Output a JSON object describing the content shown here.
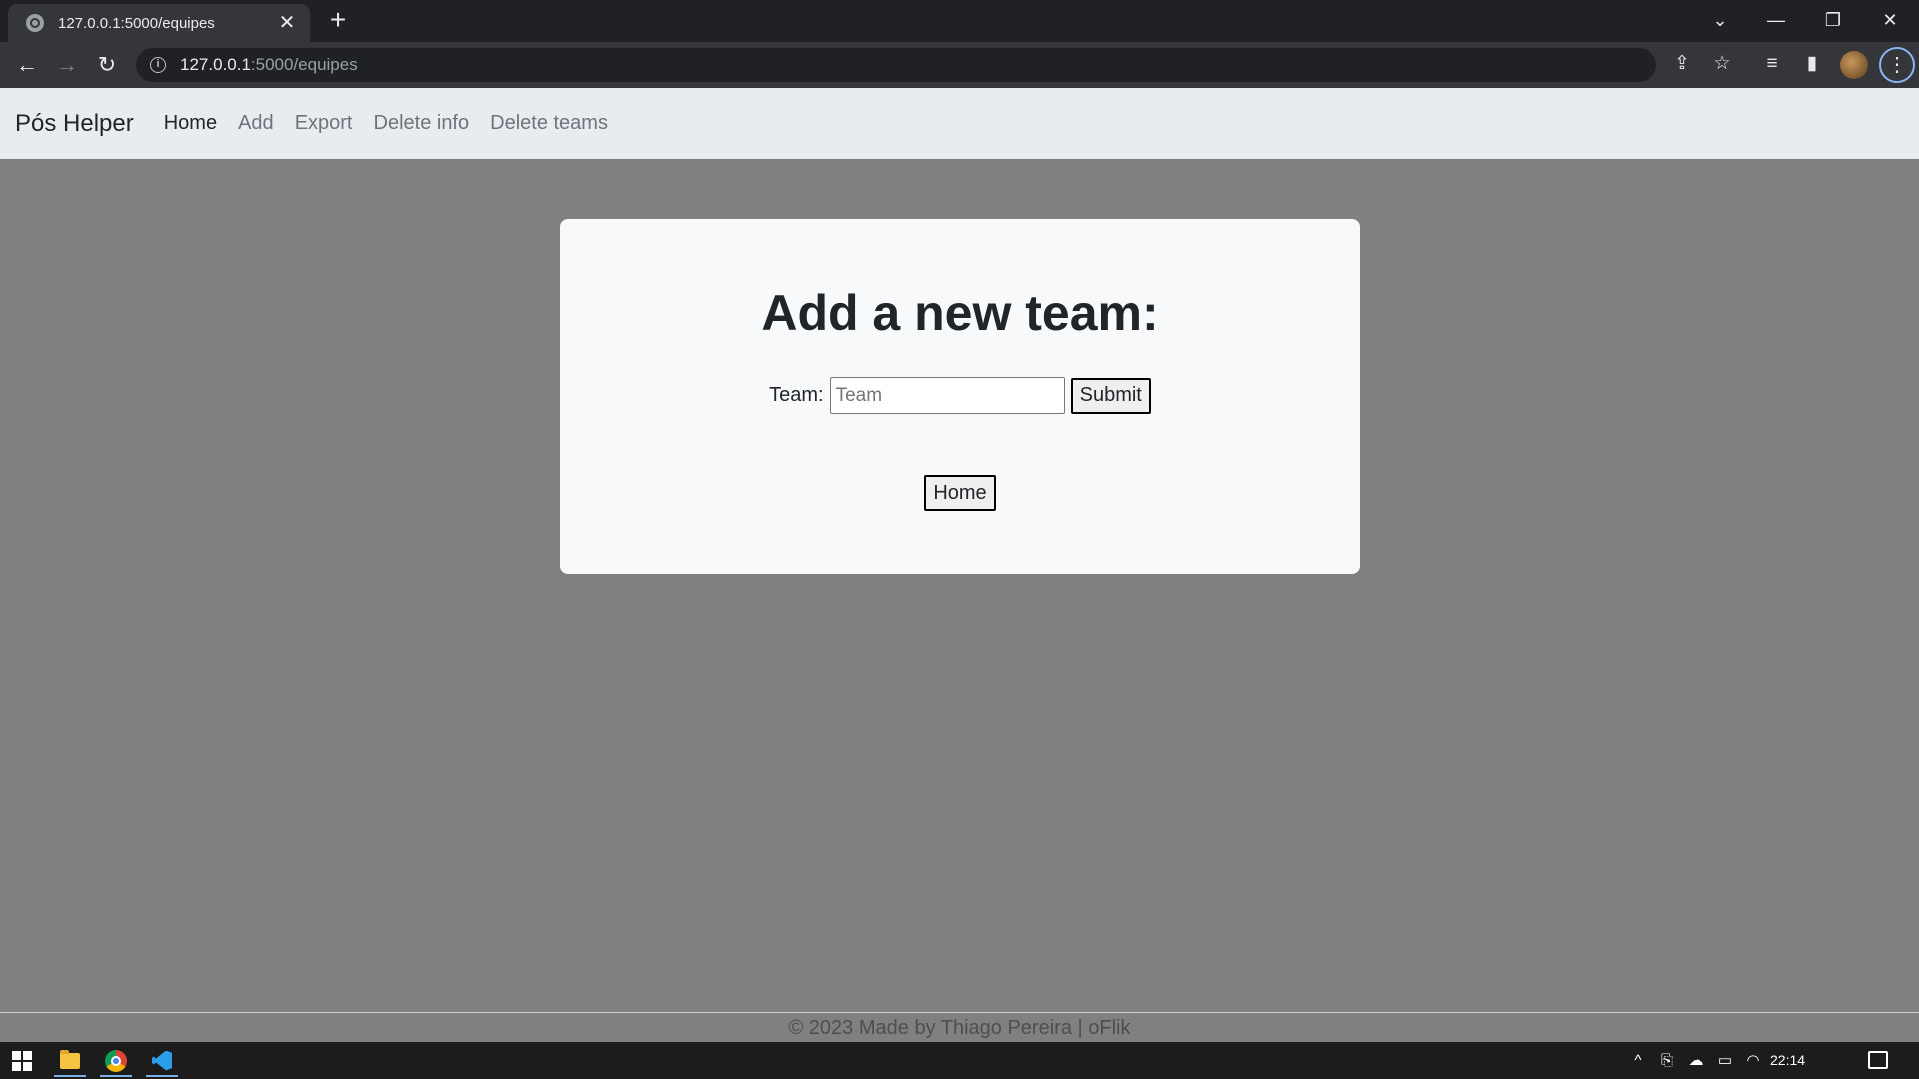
{
  "browser": {
    "tab_title": "127.0.0.1:5000/equipes",
    "tab_close_glyph": "✕",
    "new_tab_glyph": "+",
    "url_host": "127.0.0.1",
    "url_path": ":5000/equipes",
    "window_controls": {
      "dropdown": "⌄",
      "minimize": "—",
      "restore": "❐",
      "close": "✕"
    },
    "toolbar_glyphs": {
      "back": "←",
      "forward": "→",
      "reload": "↻",
      "info": "i",
      "share": "⇪",
      "bookmark": "☆",
      "reading_list": "≡",
      "side_panel": "▮",
      "menu": "⋮"
    }
  },
  "navbar": {
    "brand": "Pós Helper",
    "links": [
      {
        "label": "Home",
        "active": true
      },
      {
        "label": "Add",
        "active": false
      },
      {
        "label": "Export",
        "active": false
      },
      {
        "label": "Delete info",
        "active": false
      },
      {
        "label": "Delete teams",
        "active": false
      }
    ]
  },
  "card": {
    "heading": "Add a new team:",
    "team_label": "Team:",
    "team_input": {
      "value": "",
      "placeholder": "Team"
    },
    "submit_label": "Submit",
    "home_label": "Home"
  },
  "footer": {
    "text": "© 2023 Made by Thiago Pereira | oFlik"
  },
  "taskbar": {
    "apps": [
      "start-icon",
      "file-explorer-icon",
      "chrome-icon",
      "vscode-icon"
    ],
    "tray_glyphs": {
      "chevron": "^",
      "meet": "⎘",
      "cloud": "☁",
      "battery": "▭",
      "wifi": "◠",
      "volume": "🕪"
    },
    "clock": "22:14"
  },
  "colors": {
    "page_background": "#808080",
    "navbar_background": "#e9ecef",
    "card_background": "#f8f9fa",
    "browser_chrome": "#202124"
  }
}
